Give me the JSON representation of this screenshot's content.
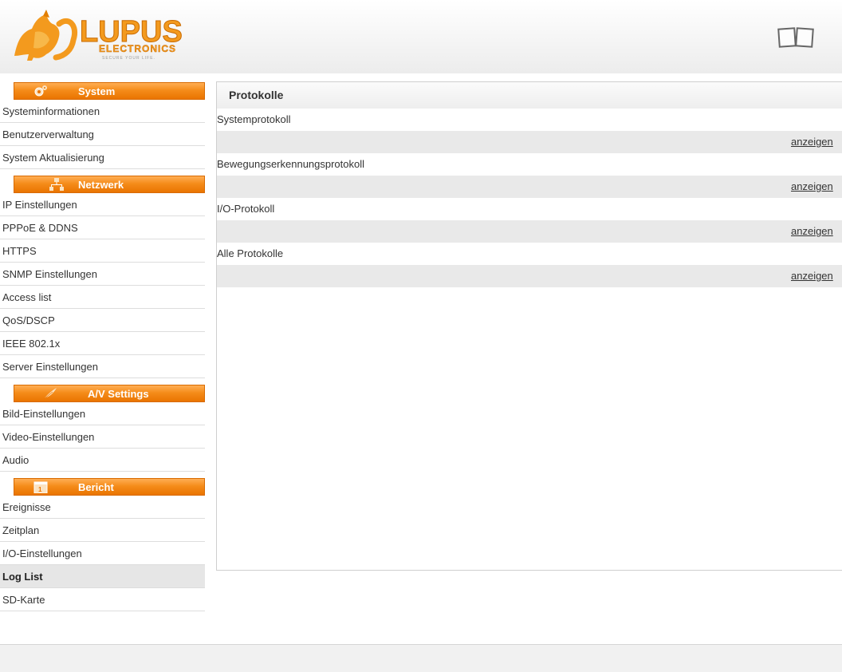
{
  "brand": {
    "name": "LUPUS",
    "subname": "ELECTRONICS",
    "tagline": "SECURE YOUR LIFE.",
    "accent_color": "#f58c1a"
  },
  "header": {
    "toggle_icon": "dual-screen-icon"
  },
  "sidebar": {
    "sections": [
      {
        "label": "System",
        "icon": "gear-icon",
        "items": [
          "Systeminformationen",
          "Benutzerverwaltung",
          "System Aktualisierung"
        ]
      },
      {
        "label": "Netzwerk",
        "icon": "network-icon",
        "items": [
          "IP Einstellungen",
          "PPPoE & DDNS",
          "HTTPS",
          "SNMP Einstellungen",
          "Access list",
          "QoS/DSCP",
          "IEEE 802.1x",
          "Server Einstellungen"
        ]
      },
      {
        "label": "A/V Settings",
        "icon": "feather-icon",
        "items": [
          "Bild-Einstellungen",
          "Video-Einstellungen",
          "Audio"
        ]
      },
      {
        "label": "Bericht",
        "icon": "calendar-icon",
        "items": [
          "Ereignisse",
          "Zeitplan",
          "I/O-Einstellungen",
          "Log List",
          "SD-Karte"
        ]
      }
    ],
    "active_item": "Log List"
  },
  "panel": {
    "title": "Protokolle",
    "logs": [
      {
        "label": "Systemprotokoll",
        "link": "anzeigen"
      },
      {
        "label": "Bewegungserkennungsprotokoll",
        "link": "anzeigen"
      },
      {
        "label": "I/O-Protokoll",
        "link": "anzeigen"
      },
      {
        "label": "Alle Protokolle",
        "link": "anzeigen"
      }
    ]
  }
}
